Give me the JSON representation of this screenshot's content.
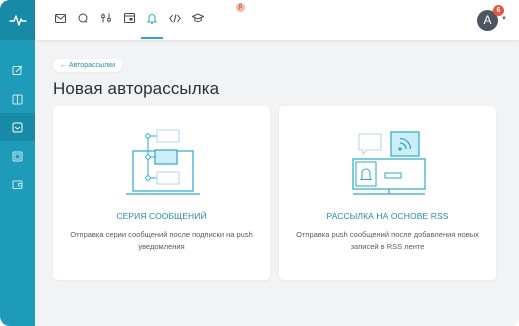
{
  "sidebar": {
    "logo_icon": "pulse-icon",
    "items": [
      {
        "icon": "edit-icon",
        "active": false
      },
      {
        "icon": "columns-icon",
        "active": false
      },
      {
        "icon": "mail-automation-icon",
        "active": true
      },
      {
        "icon": "list-icon",
        "active": false
      },
      {
        "icon": "wallet-icon",
        "active": false
      }
    ]
  },
  "topbar": {
    "icons": [
      "mail-icon",
      "chat-icon",
      "sliders-icon",
      "browser-icon",
      "bell-icon",
      "code-icon",
      "graduation-cap-icon"
    ],
    "active_icon": "bell-icon",
    "beta_badge": "β",
    "avatar_letter": "A",
    "notifications_count": "6"
  },
  "back_link": "← Авторассылки",
  "page_title": "Новая авторассылка",
  "cards": [
    {
      "title": "СЕРИЯ СООБЩЕНИЙ",
      "description": "Отправка серии сообщений после подписки на push уведомления",
      "icon": "message-series-illustration"
    },
    {
      "title": "РАССЫЛКА НА ОСНОВЕ RSS",
      "description": "Отправка push сообщений после добавления новых записей в RSS ленте",
      "icon": "rss-illustration"
    }
  ],
  "colors": {
    "sidebar": "#1e9bb9",
    "accent": "#2191b0",
    "background": "#f2f3f5"
  }
}
